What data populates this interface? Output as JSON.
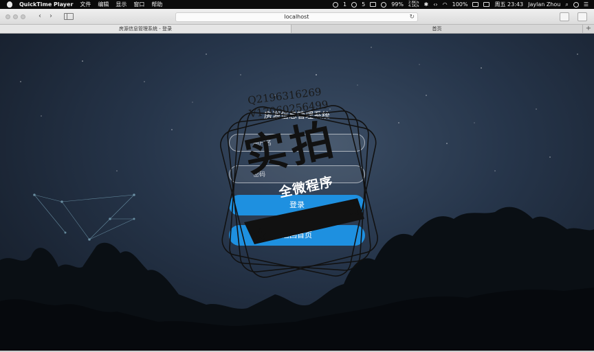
{
  "menubar": {
    "app_name": "QuickTime Player",
    "menus": [
      "文件",
      "编辑",
      "显示",
      "窗口",
      "帮助"
    ],
    "status": {
      "notify_count_1": "1",
      "notify_count_2": "5",
      "battery_ring": "99%",
      "net_up": "2.8K/s",
      "net_down": "4.1K/s",
      "battery": "100%",
      "clock": "周五 23:43",
      "user": "Jaylan Zhou"
    }
  },
  "browser": {
    "address": "localhost",
    "tabs": [
      {
        "label": "房源信息管理系统 - 登录",
        "active": true
      },
      {
        "label": "首页",
        "active": false
      }
    ],
    "new_tab": "+"
  },
  "login": {
    "title": "房源信息管理系统",
    "username_placeholder": "用户名",
    "password_placeholder": "密码",
    "login_button": "登录",
    "home_button": "返回首页"
  },
  "watermark": {
    "line1": "Q2196316269",
    "line2": "V17060256499",
    "big_text": "实拍",
    "ribbon_text": "全微程序"
  },
  "colors": {
    "button_blue": "#1e90e0",
    "background_sky": "#26354a"
  },
  "icons": [
    "apple-icon",
    "back-icon",
    "forward-icon",
    "sidebar-icon",
    "reload-icon",
    "share-icon",
    "tabs-icon",
    "search-icon",
    "siri-icon",
    "list-icon",
    "wifi-icon",
    "bluetooth-icon",
    "wechat-icon"
  ]
}
